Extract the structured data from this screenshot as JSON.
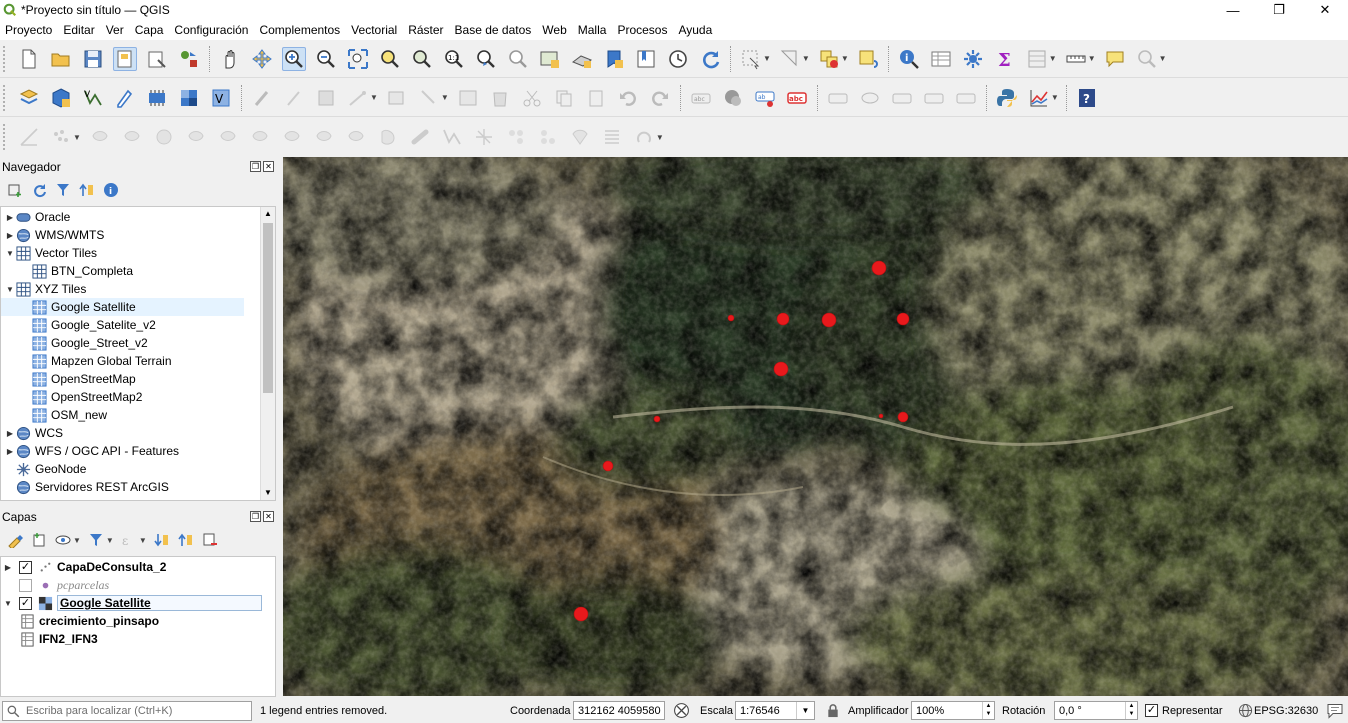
{
  "window": {
    "title": "*Proyecto sin título — QGIS",
    "controls": [
      "—",
      "❐",
      "✕"
    ]
  },
  "menu": [
    "Proyecto",
    "Editar",
    "Ver",
    "Capa",
    "Configuración",
    "Complementos",
    "Vectorial",
    "Ráster",
    "Base de datos",
    "Web",
    "Malla",
    "Procesos",
    "Ayuda"
  ],
  "browser": {
    "title": "Navegador",
    "items": [
      {
        "label": "Oracle",
        "icon": "database-icon",
        "arrow": "▶"
      },
      {
        "label": "WMS/WMTS",
        "icon": "globe-icon",
        "arrow": "▶"
      },
      {
        "label": "Vector Tiles",
        "icon": "grid-icon",
        "arrow": "▼"
      },
      {
        "label": "BTN_Completa",
        "icon": "grid-icon",
        "arrow": ""
      },
      {
        "label": "XYZ Tiles",
        "icon": "grid-icon",
        "arrow": "▼"
      },
      {
        "label": "Google Satellite",
        "icon": "tiles-icon",
        "arrow": ""
      },
      {
        "label": "Google_Satelite_v2",
        "icon": "tiles-icon",
        "arrow": ""
      },
      {
        "label": "Google_Street_v2",
        "icon": "tiles-icon",
        "arrow": ""
      },
      {
        "label": "Mapzen Global Terrain",
        "icon": "tiles-icon",
        "arrow": ""
      },
      {
        "label": "OpenStreetMap",
        "icon": "tiles-icon",
        "arrow": ""
      },
      {
        "label": "OpenStreetMap2",
        "icon": "tiles-icon",
        "arrow": ""
      },
      {
        "label": "OSM_new",
        "icon": "tiles-icon",
        "arrow": ""
      },
      {
        "label": "WCS",
        "icon": "globe-icon",
        "arrow": "▶"
      },
      {
        "label": "WFS / OGC API - Features",
        "icon": "globe-icon",
        "arrow": "▶"
      },
      {
        "label": "GeoNode",
        "icon": "geonode-icon",
        "arrow": ""
      },
      {
        "label": "Servidores REST ArcGIS",
        "icon": "globe-icon",
        "arrow": ""
      }
    ]
  },
  "layers": {
    "title": "Capas",
    "items": [
      {
        "label": "CapaDeConsulta_2",
        "checked": "✓",
        "arrow": "▶"
      },
      {
        "label": "pcparcelas",
        "checked": "",
        "arrow": ""
      },
      {
        "label": "Google Satellite",
        "checked": "✓",
        "arrow": "▼"
      },
      {
        "label": "crecimiento_pinsapo",
        "checked": "",
        "arrow": ""
      },
      {
        "label": "IFN2_IFN3",
        "checked": "",
        "arrow": ""
      }
    ]
  },
  "status": {
    "locator_placeholder": "Escriba para localizar (Ctrl+K)",
    "message": "1 legend entries removed.",
    "coord_label": "Coordenada",
    "coord_value": "312162 4059580",
    "scale_label": "Escala",
    "scale_value": "1:76546",
    "magnifier_label": "Amplificador",
    "magnifier_value": "100%",
    "rotation_label": "Rotación",
    "rotation_value": "0,0 °",
    "render_label": "Representar",
    "crs": "EPSG:32630"
  },
  "colors": {
    "point": "#e8191c",
    "selection": "#e5f3ff",
    "accent": "#3c78c8"
  }
}
